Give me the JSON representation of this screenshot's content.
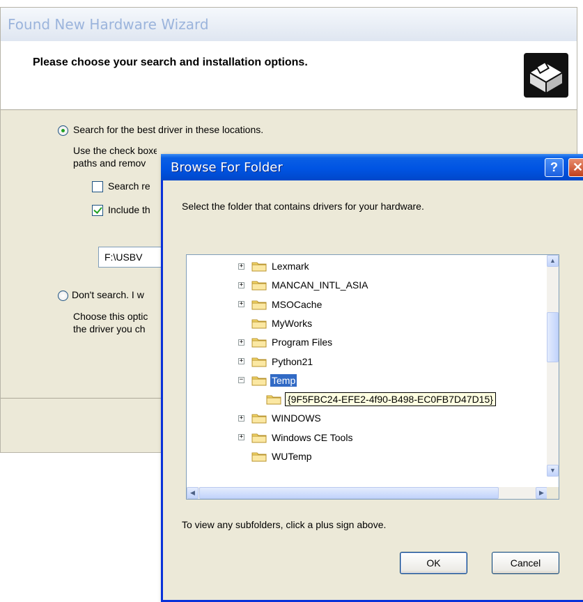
{
  "wizard": {
    "title": "Found New Hardware Wizard",
    "heading": "Please choose your search and installation options.",
    "option_search": "Search for the best driver in these locations.",
    "search_desc_line1": "Use the check boxes below to limit or expand the default search, which includes local",
    "search_desc_line2": "paths and remov",
    "checkbox_search_removable": "Search re",
    "checkbox_include": "Include th",
    "path_value": "F:\\USBV",
    "option_dont_search": "Don't search. I w",
    "dont_desc_line1": "Choose this optic",
    "dont_desc_line2": "the driver you ch"
  },
  "dialog": {
    "title": "Browse For Folder",
    "help_glyph": "?",
    "close_glyph": "✕",
    "description": "Select the folder that contains drivers for your hardware.",
    "hint": "To view any subfolders, click a plus sign above.",
    "ok_label": "OK",
    "cancel_label": "Cancel",
    "tree": [
      {
        "label": "Lexmark",
        "expander": "+"
      },
      {
        "label": "MANCAN_INTL_ASIA",
        "expander": "+"
      },
      {
        "label": "MSOCache",
        "expander": "+"
      },
      {
        "label": "MyWorks",
        "expander": ""
      },
      {
        "label": "Program Files",
        "expander": "+"
      },
      {
        "label": "Python21",
        "expander": "+"
      },
      {
        "label": "Temp",
        "expander": "−",
        "selected": true
      },
      {
        "label": "{9F5FBC24-EFE2-4f90-B498-EC0FB7D47D15}",
        "expander": "",
        "child": true
      },
      {
        "label": "WINDOWS",
        "expander": "+"
      },
      {
        "label": "Windows CE Tools",
        "expander": "+"
      },
      {
        "label": "WUTemp",
        "expander": ""
      }
    ],
    "scroll_up": "▲",
    "scroll_down": "▼",
    "scroll_left": "◀",
    "scroll_right": "▶"
  },
  "colors": {
    "titlebar_blue": "#0054e3",
    "selection": "#316ac5",
    "folder": "#f5d86b"
  }
}
